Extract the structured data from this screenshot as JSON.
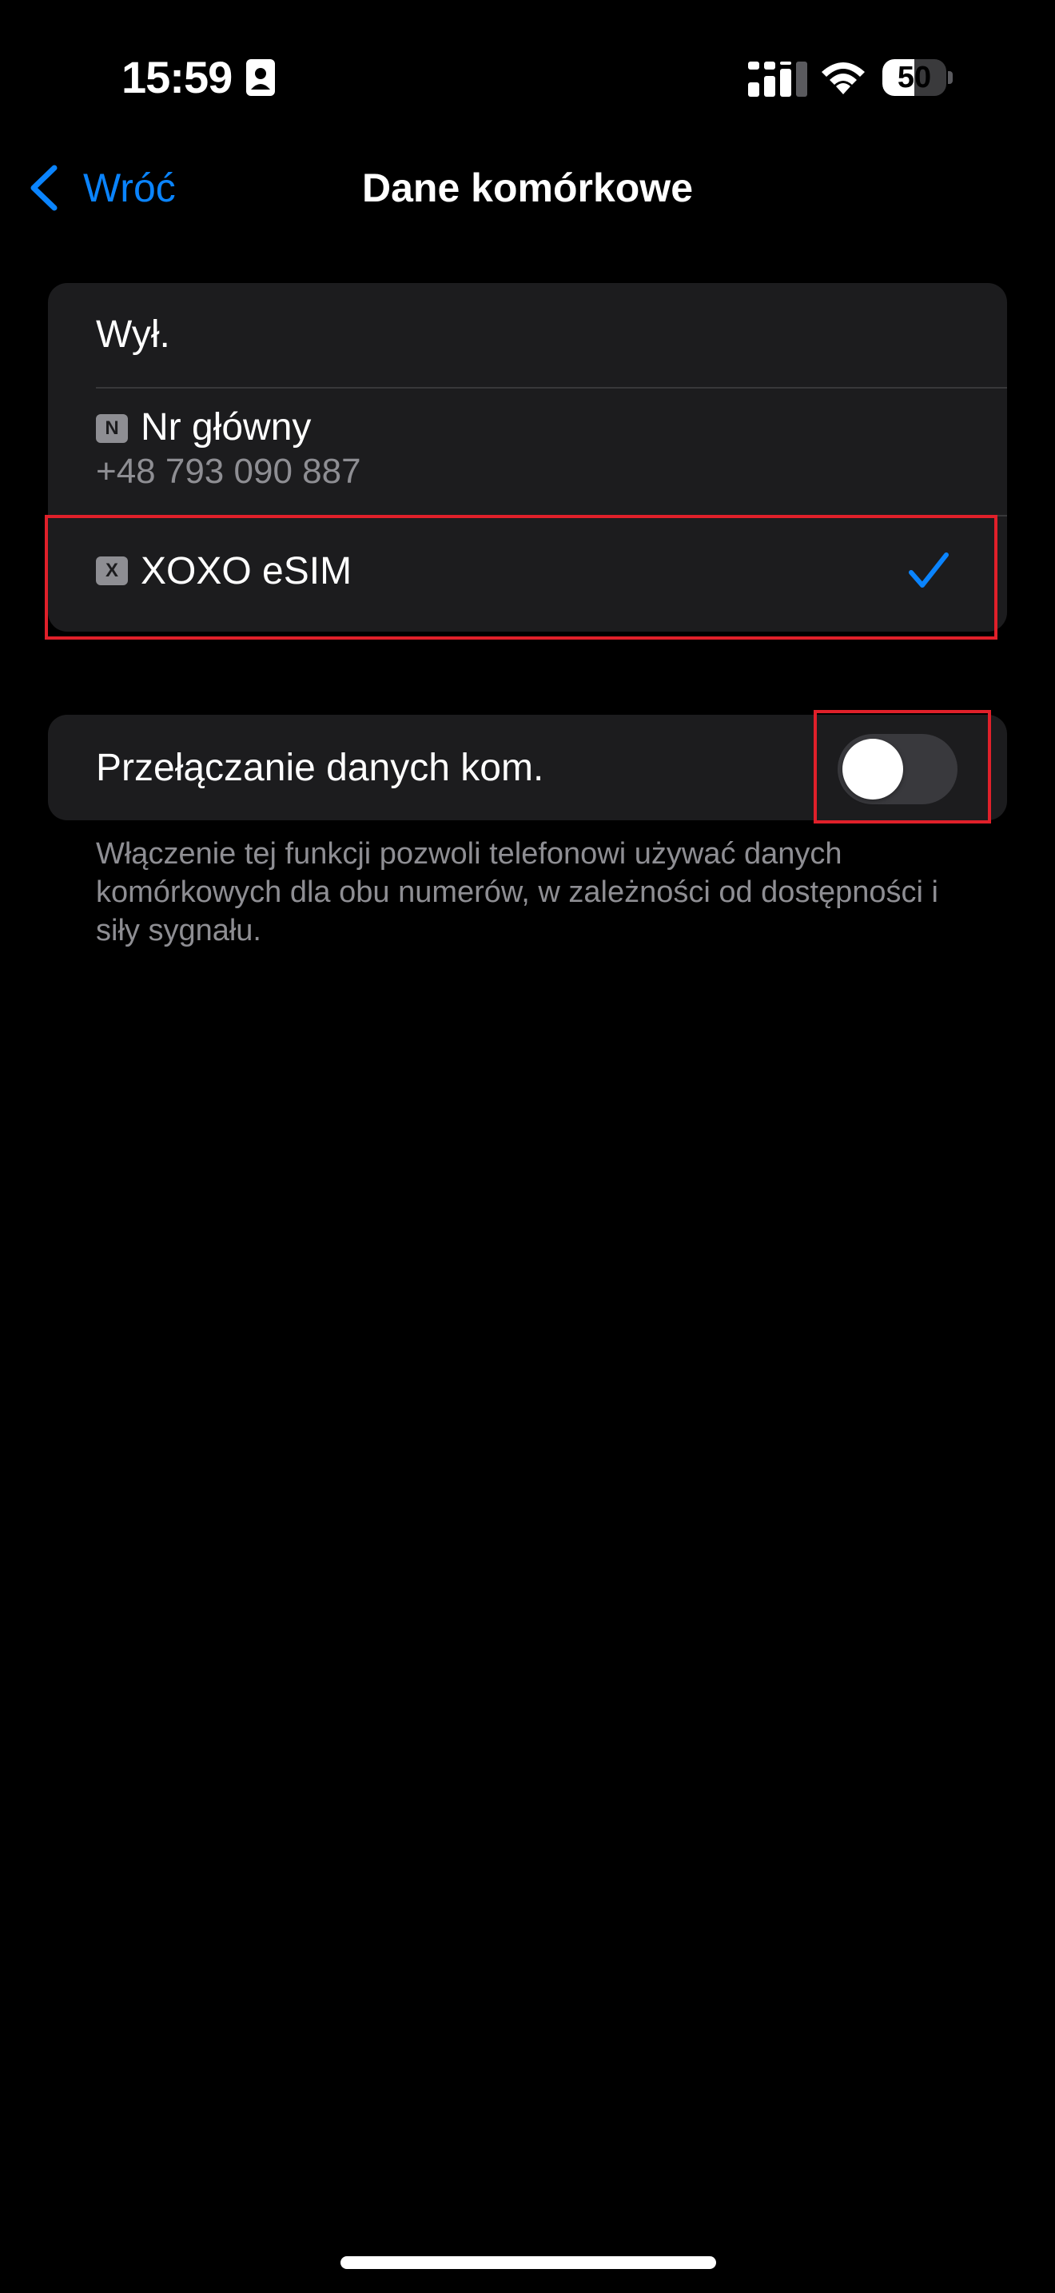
{
  "status_bar": {
    "time": "15:59",
    "battery_level": "50",
    "battery_percent": 50,
    "icons": [
      "id-card-icon",
      "cellular-signal-icon",
      "wifi-icon",
      "battery-icon"
    ]
  },
  "nav": {
    "back_label": "Wróć",
    "title": "Dane komórkowe"
  },
  "data_line_options": [
    {
      "label": "Wył.",
      "selected": false
    },
    {
      "badge": "N",
      "label": "Nr główny",
      "number": "+48 793 090 887",
      "selected": false
    },
    {
      "badge": "X",
      "label": "XOXO eSIM",
      "selected": true
    }
  ],
  "data_switching": {
    "label": "Przełączanie danych kom.",
    "enabled": false,
    "footer": "Włączenie tej funkcji pozwoli telefonowi używać danych komórkowych dla obu numerów, w zależności od dostępności i siły sygnału."
  },
  "colors": {
    "accent": "#0a84ff",
    "background": "#000000",
    "group_background": "#1c1c1e",
    "highlight": "#e0202a",
    "secondary_text": "#8e8e93"
  }
}
